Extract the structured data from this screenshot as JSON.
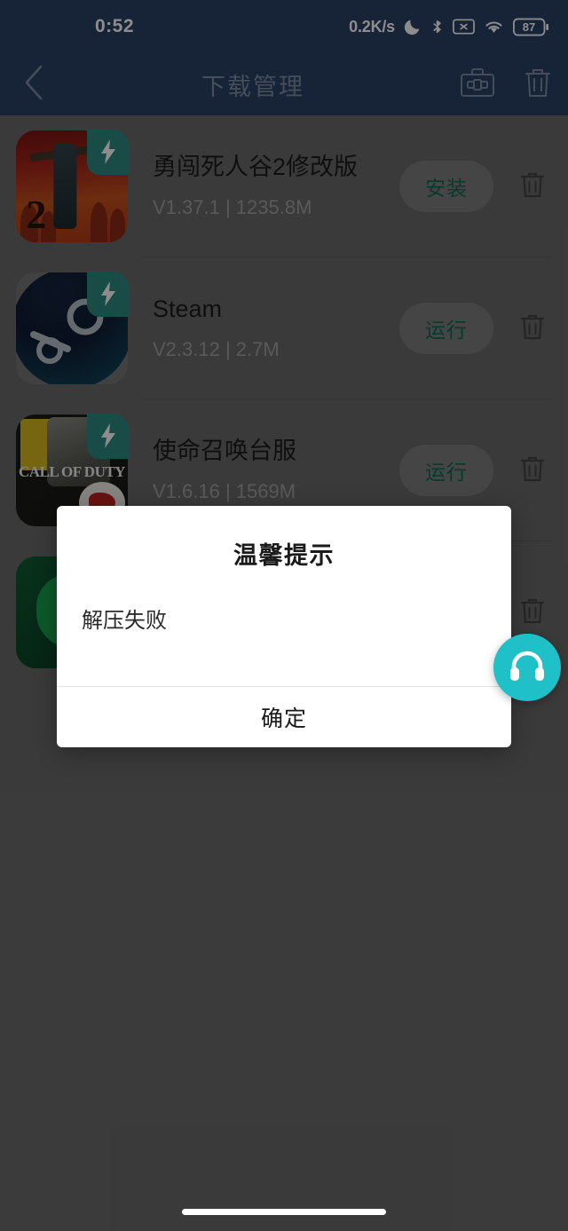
{
  "status_bar": {
    "time": "0:52",
    "network_speed": "0.2K/s",
    "battery_level": "87",
    "icons": [
      "moon-icon",
      "bluetooth-icon",
      "no-sim-icon",
      "wifi-icon",
      "battery-icon"
    ]
  },
  "app_bar": {
    "title": "下载管理",
    "back_icon": "chevron-left-icon",
    "toolbox_icon": "toolbox-icon",
    "trash_icon": "trash-icon"
  },
  "downloads": [
    {
      "name": "勇闯死人谷2修改版",
      "version": "V1.37.1",
      "size": "1235.8M",
      "meta": "V1.37.1 | 1235.8M",
      "action_label": "安装",
      "icon": "zombie-game-icon",
      "badge_icon": "lightning-bolt-icon"
    },
    {
      "name": "Steam",
      "version": "V2.3.12",
      "size": "2.7M",
      "meta": "V2.3.12 | 2.7M",
      "action_label": "运行",
      "icon": "steam-icon",
      "badge_icon": "lightning-bolt-icon"
    },
    {
      "name": "使命召唤台服",
      "version": "V1.6.16",
      "size": "1569M",
      "meta": "V1.6.16 | 1569M",
      "action_label": "运行",
      "icon": "call-of-duty-icon",
      "badge_icon": "lightning-bolt-icon"
    },
    {
      "name": "",
      "version": "",
      "size": "",
      "meta": "",
      "action_label": "",
      "icon": "green-app-icon",
      "badge_icon": "lightning-bolt-icon"
    }
  ],
  "dialog": {
    "title": "温馨提示",
    "message": "解压失败",
    "confirm_label": "确定"
  },
  "fab": {
    "icon": "headphones-icon"
  },
  "colors": {
    "header_blue": "#2a4366",
    "accent_green": "#0e6b4f",
    "badge_teal": "#2e8b80",
    "fab_teal": "#1fc0c8",
    "scrim": "rgba(0,0,0,0.45)",
    "page_gray": "#6b6b6b"
  }
}
